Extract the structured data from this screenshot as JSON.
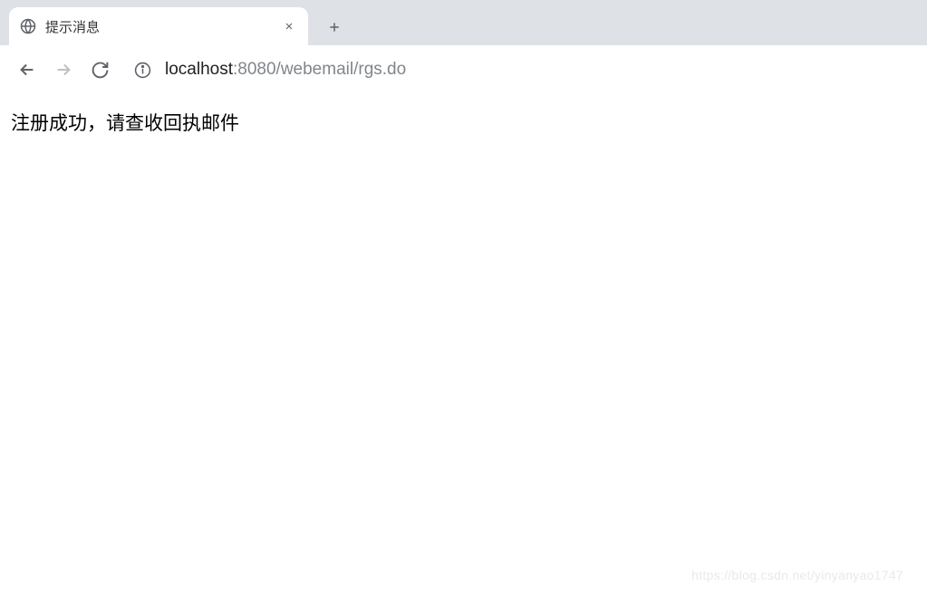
{
  "tab": {
    "title": "提示消息"
  },
  "address": {
    "host": "localhost",
    "port": ":8080",
    "path": "/webemail/rgs.do"
  },
  "page": {
    "message": "注册成功，请查收回执邮件"
  },
  "watermark": "https://blog.csdn.net/yinyanyao1747"
}
